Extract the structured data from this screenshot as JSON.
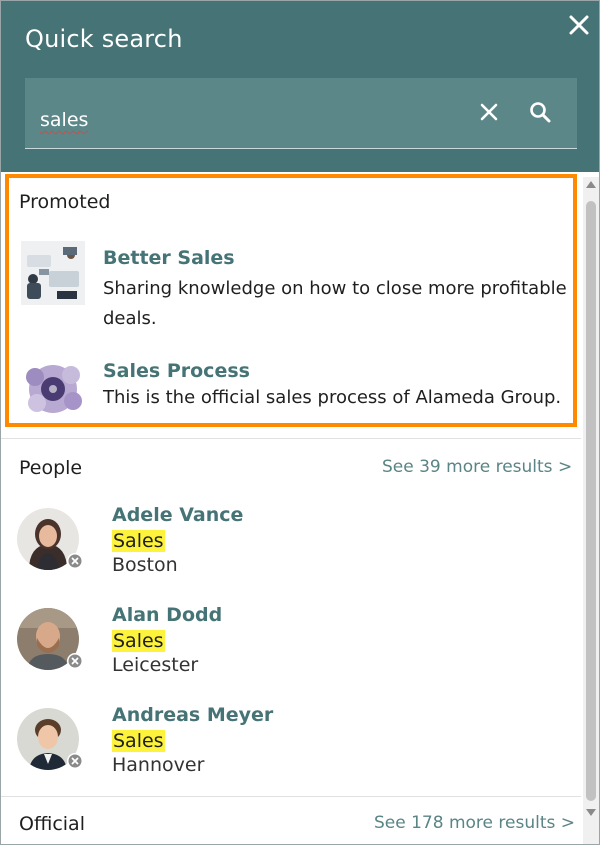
{
  "header": {
    "title": "Quick search",
    "close_icon": "close-icon"
  },
  "search": {
    "value": "sales",
    "clear_icon": "clear-icon",
    "search_icon": "search-icon"
  },
  "promoted": {
    "label": "Promoted",
    "items": [
      {
        "title": "Better Sales",
        "description": "Sharing knowledge on how to close more profitable deals."
      },
      {
        "title": "Sales Process",
        "description": "This is the official sales process of Alameda Group."
      }
    ]
  },
  "people": {
    "label": "People",
    "see_more": "See 39 more results >",
    "items": [
      {
        "name": "Adele Vance",
        "department": "Sales",
        "location": "Boston"
      },
      {
        "name": "Alan Dodd",
        "department": "Sales",
        "location": "Leicester"
      },
      {
        "name": "Andreas Meyer",
        "department": "Sales",
        "location": "Hannover"
      }
    ]
  },
  "official": {
    "label": "Official",
    "see_more": "See 178 more results >"
  },
  "colors": {
    "header_bg": "#467375",
    "accent_text": "#467375",
    "highlight": "#fdf33c",
    "promoted_border": "#ff8a00"
  }
}
